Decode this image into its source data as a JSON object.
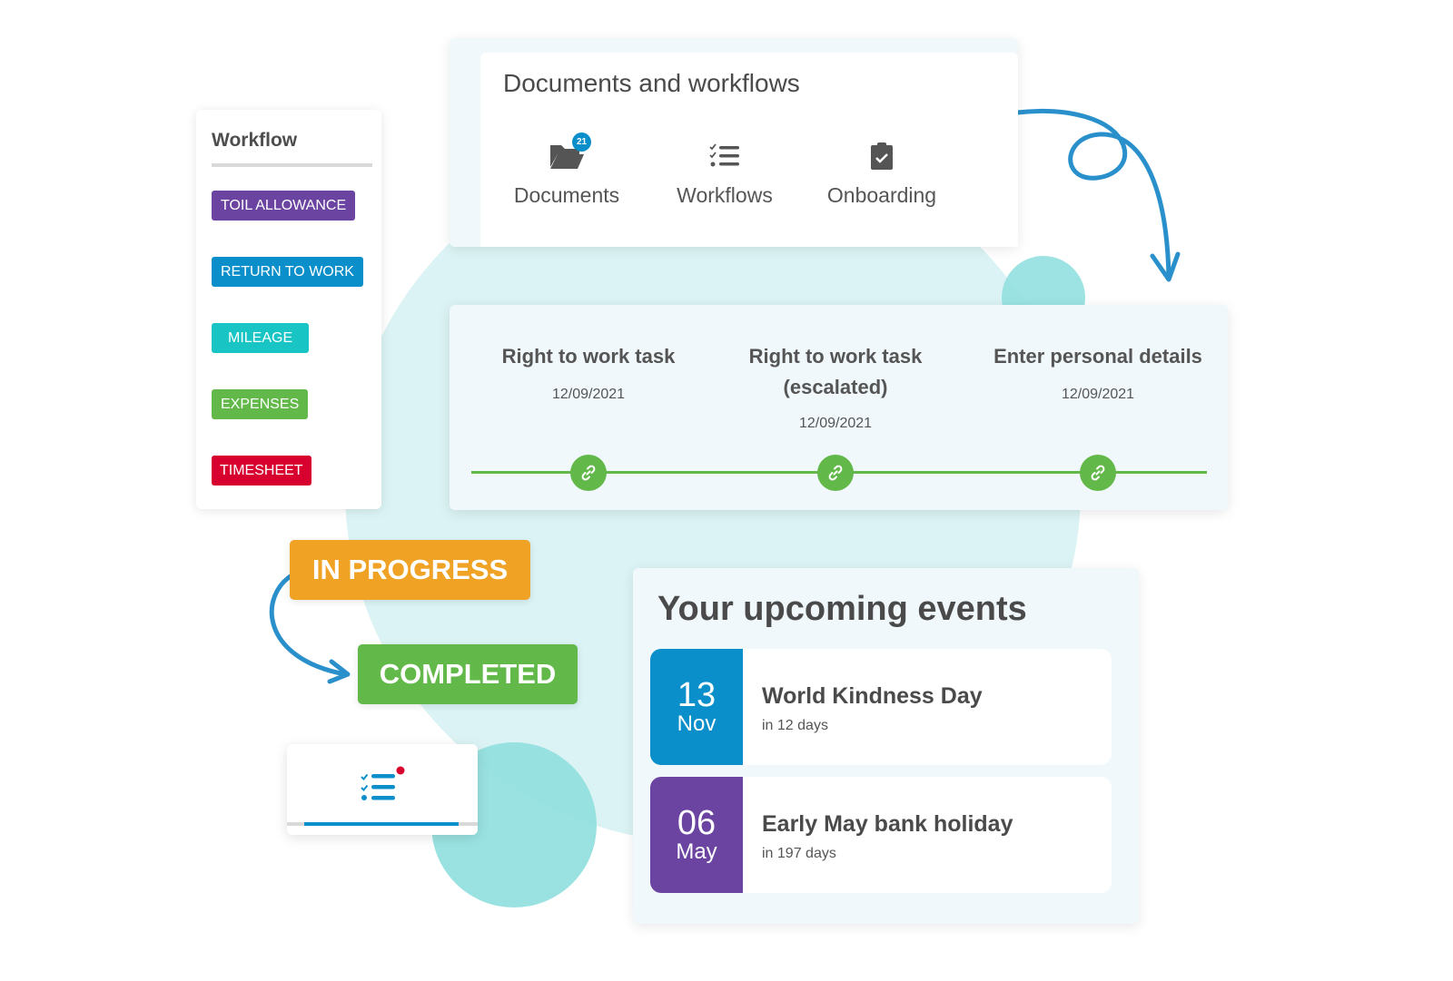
{
  "colors": {
    "purple": "#6a44a0",
    "blue": "#0a8fcb",
    "teal": "#19c4c4",
    "green": "#62b94a",
    "red": "#d8002f",
    "orange": "#f0a224",
    "arrow": "#2a90cc"
  },
  "workflow": {
    "title": "Workflow",
    "tags": [
      {
        "label": "TOIL ALLOWANCE",
        "color": "#6a44a0"
      },
      {
        "label": "RETURN TO WORK",
        "color": "#0a8fcb"
      },
      {
        "label": "MILEAGE",
        "color": "#19c4c4"
      },
      {
        "label": "EXPENSES",
        "color": "#62b94a"
      },
      {
        "label": "TIMESHEET",
        "color": "#d8002f"
      }
    ]
  },
  "documents_panel": {
    "title": "Documents and workflows",
    "items": [
      {
        "label": "Documents",
        "icon": "folder-open-icon",
        "badge": "21"
      },
      {
        "label": "Workflows",
        "icon": "checklist-icon"
      },
      {
        "label": "Onboarding",
        "icon": "clipboard-check-icon"
      }
    ]
  },
  "timeline": {
    "steps": [
      {
        "title": "Right to work task",
        "date": "12/09/2021",
        "icon": "link-icon"
      },
      {
        "title": "Right to work task (escalated)",
        "date": "12/09/2021",
        "icon": "link-icon"
      },
      {
        "title": "Enter personal details",
        "date": "12/09/2021",
        "icon": "link-icon"
      }
    ]
  },
  "status_flow": {
    "from": "IN PROGRESS",
    "to": "COMPLETED"
  },
  "mini_widget": {
    "icon": "checklist-icon",
    "has_notification": true,
    "progress": 0.81
  },
  "events": {
    "title": "Your upcoming events",
    "items": [
      {
        "day": "13",
        "month": "Nov",
        "name": "World Kindness Day",
        "relative": "in 12 days",
        "color": "#0a8fcb"
      },
      {
        "day": "06",
        "month": "May",
        "name": "Early May bank holiday",
        "relative": "in 197 days",
        "color": "#6a44a0"
      }
    ]
  }
}
